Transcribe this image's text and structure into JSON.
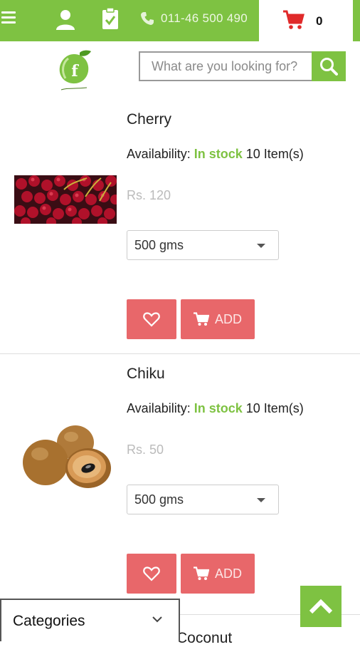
{
  "topbar": {
    "phone": "011-46 500 490",
    "cart_count": "0"
  },
  "search": {
    "placeholder": "What are you looking for?"
  },
  "products": [
    {
      "name": "Cherry",
      "availability_label": "Availability:",
      "stock_status": "In stock",
      "quantity": "10 Item(s)",
      "price": "Rs. 120",
      "size_selected": "500 gms",
      "add_label": "ADD"
    },
    {
      "name": "Chiku",
      "availability_label": "Availability:",
      "stock_status": "In stock",
      "quantity": "10 Item(s)",
      "price": "Rs. 50",
      "size_selected": "500 gms",
      "add_label": "ADD"
    }
  ],
  "next_product_partial": "Coconut",
  "footer": {
    "categories_label": "Categories"
  },
  "colors": {
    "brand_green": "#7ec242",
    "button_red": "#e8676a",
    "cart_red": "#e02a2a"
  }
}
